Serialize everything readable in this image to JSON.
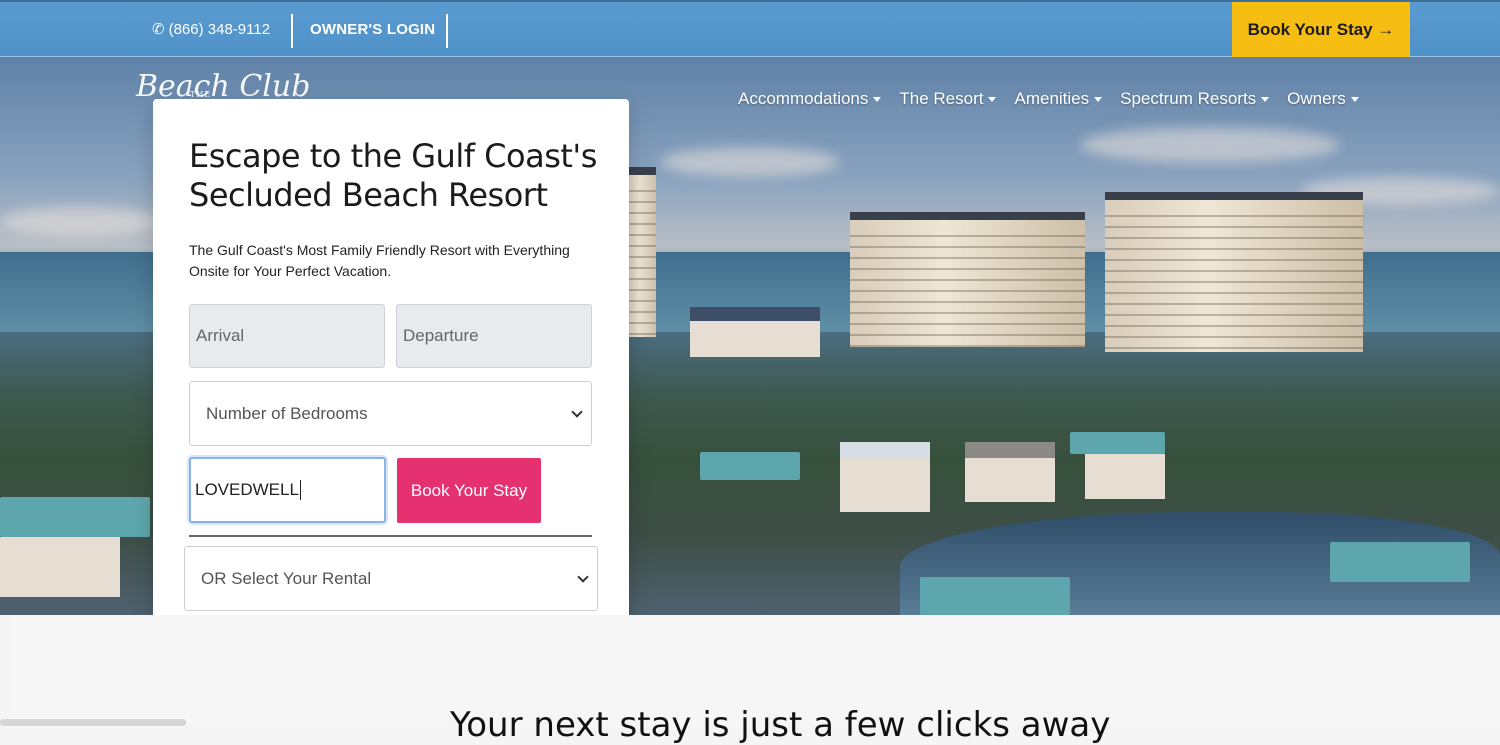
{
  "topbar": {
    "phone_icon": "phone-icon",
    "phone": "(866) 348-9112",
    "owner_login": "OWNER'S LOGIN",
    "book_label": "Book Your Stay →",
    "book_color": "#f6bd13"
  },
  "logo": {
    "script_text": "Beach Club",
    "small_text": "THE"
  },
  "nav": {
    "items": [
      {
        "label": "Accommodations"
      },
      {
        "label": "The Resort"
      },
      {
        "label": "Amenities"
      },
      {
        "label": "Spectrum Resorts"
      },
      {
        "label": "Owners"
      }
    ]
  },
  "booking": {
    "heading": "Escape to the Gulf Coast's Secluded Beach Resort",
    "subtext": "The Gulf Coast's Most Family Friendly Resort with Everything Onsite for Your Perfect Vacation.",
    "arrival_placeholder": "Arrival",
    "departure_placeholder": "Departure",
    "bedrooms_selected": "Number of Bedrooms",
    "promo_value": "LOVEDWELL",
    "book_label": "Book Your Stay",
    "book_color": "#e53170",
    "rental_selected": "OR Select Your Rental"
  },
  "section": {
    "tagline": "Your next stay is just a few clicks away"
  }
}
